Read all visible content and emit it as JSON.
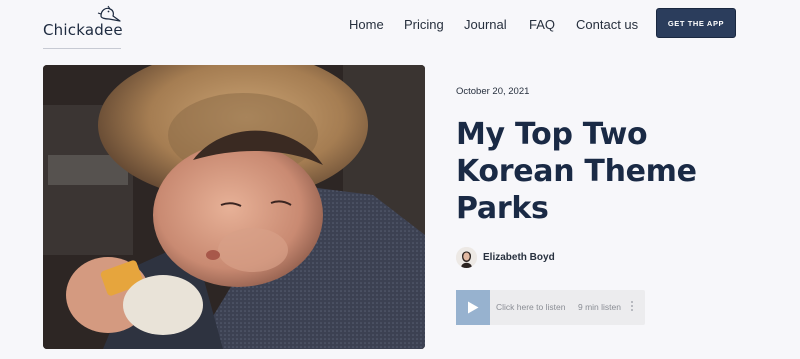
{
  "brand": {
    "name": "Chickadee",
    "logo_icon": "bird-icon"
  },
  "nav": {
    "items": [
      {
        "label": "Home"
      },
      {
        "label": "Pricing"
      },
      {
        "label": "Journal"
      },
      {
        "label": "FAQ"
      },
      {
        "label": "Contact us"
      }
    ],
    "cta_label": "GET THE APP"
  },
  "article": {
    "date": "October 20, 2021",
    "title": "My Top Two Korean Theme Parks",
    "author": "Elizabeth Boyd",
    "hero_image": "baby-in-straw-hat-car-seat-photo"
  },
  "player": {
    "play_icon": "play-icon",
    "listen_label": "Click here to listen",
    "duration": "9 min listen",
    "menu_icon": "more-vertical-icon"
  },
  "colors": {
    "background": "#f7f7fa",
    "text_dark": "#1a2a45",
    "cta_bg": "#2b3d5c",
    "play_bg": "#97b2cf",
    "player_bg": "#ececee"
  }
}
